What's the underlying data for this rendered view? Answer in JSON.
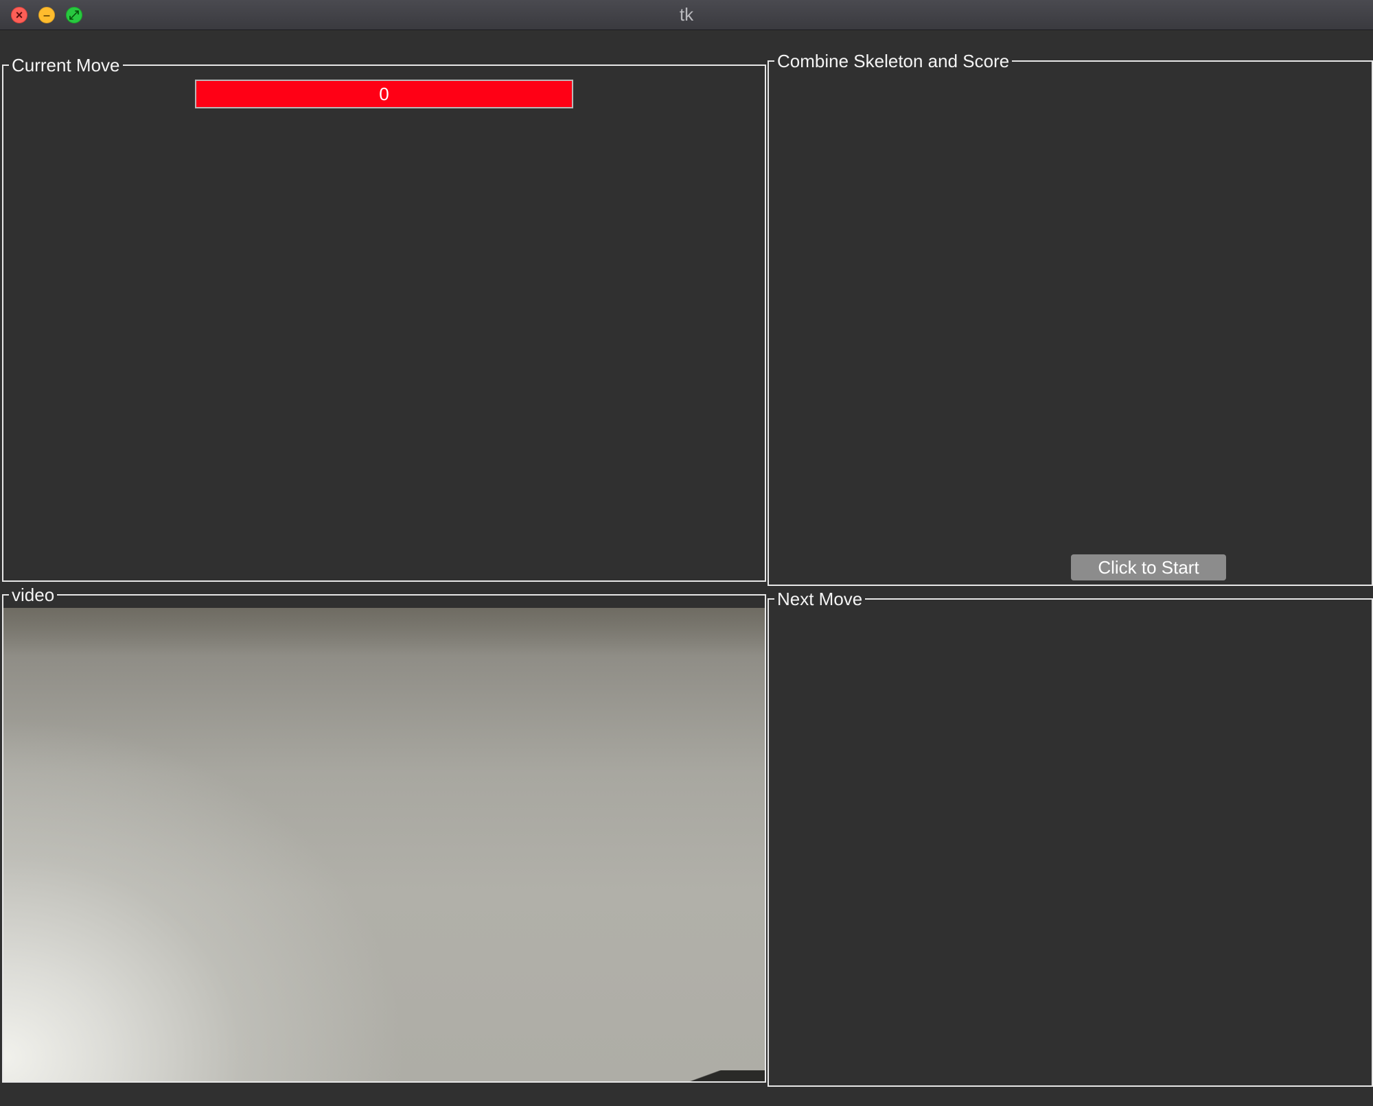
{
  "window": {
    "title": "tk",
    "controls": {
      "close": "close-icon",
      "minimize": "minimize-icon",
      "zoom": "zoom-icon"
    }
  },
  "panels": {
    "current_move": {
      "label": "Current Move",
      "score": {
        "value": "0",
        "color": "#ff0015"
      }
    },
    "combine": {
      "label": "Combine Skeleton and Score",
      "start_button_label": "Click to Start"
    },
    "video": {
      "label": "video"
    },
    "next_move": {
      "label": "Next Move"
    }
  },
  "colors": {
    "background": "#303030",
    "frame_border": "#e8e8e8",
    "button": "#8c8c8c",
    "text": "#f4f4f4"
  }
}
